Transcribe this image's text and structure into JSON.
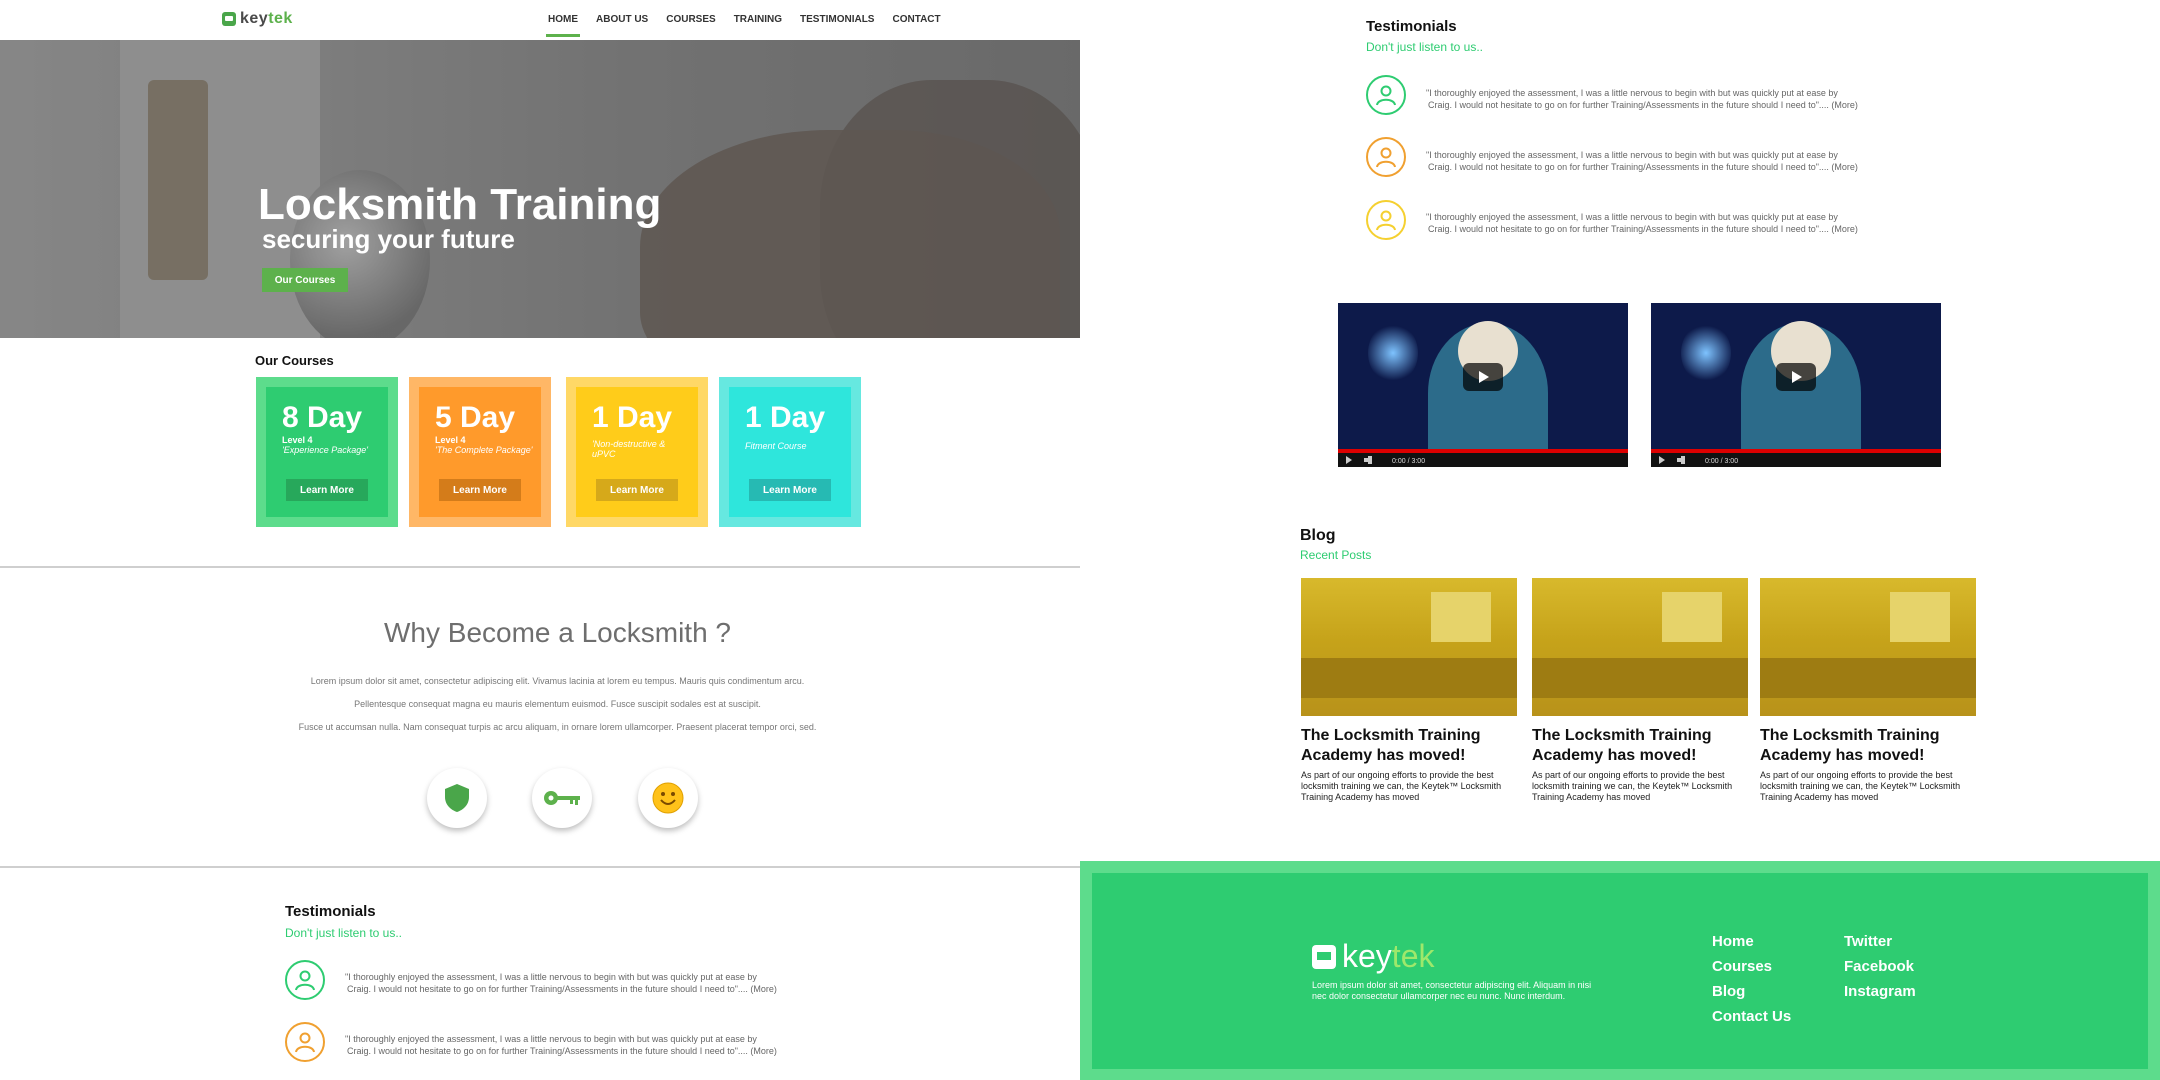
{
  "brand": {
    "logo_text_a": "key",
    "logo_text_b": "tek",
    "accent": "#5db14c",
    "green": "#2ecc71"
  },
  "nav": {
    "items": [
      {
        "label": "HOME",
        "active": true
      },
      {
        "label": "ABOUT US"
      },
      {
        "label": "COURSES"
      },
      {
        "label": "TRAINING"
      },
      {
        "label": "TESTIMONIALS"
      },
      {
        "label": "CONTACT"
      }
    ]
  },
  "hero": {
    "title": "Locksmith Training",
    "subtitle": "securing your future",
    "button": "Our Courses"
  },
  "courses": {
    "heading": "Our Courses",
    "items": [
      {
        "days": "8 Day",
        "level": "Level 4",
        "package": "'Experience Package'",
        "button": "Learn More",
        "outer": "#5ddc8c",
        "inner": "#2ecc71",
        "btn": "#27a85b"
      },
      {
        "days": "5 Day",
        "level": "Level 4",
        "package": "'The Complete Package'",
        "button": "Learn More",
        "outer": "#ffb766",
        "inner": "#ff9a2b",
        "btn": "#d47c1a"
      },
      {
        "days": "1 Day",
        "level": "",
        "package": "'Non-destructive & uPVC",
        "button": "Learn More",
        "outer": "#ffd866",
        "inner": "#ffcc1a",
        "btn": "#d6a91a"
      },
      {
        "days": "1 Day",
        "level": "",
        "package": "Fitment Course",
        "button": "Learn More",
        "outer": "#66e8e0",
        "inner": "#2ee6dc",
        "btn": "#26bab3"
      }
    ]
  },
  "why": {
    "title": "Why Become a Locksmith ?",
    "lines": [
      "Lorem ipsum dolor sit amet, consectetur adipiscing elit. Vivamus lacinia at lorem eu tempus. Mauris quis condimentum arcu.",
      "Pellentesque consequat magna eu mauris elementum euismod. Fusce suscipit sodales est at suscipit.",
      "Fusce ut accumsan nulla. Nam consequat turpis ac arcu aliquam, in ornare lorem ullamcorper. Praesent placerat tempor orci, sed."
    ],
    "icons": [
      "shield-icon",
      "key-icon",
      "smiley-icon"
    ]
  },
  "testimonials": {
    "title": "Testimonials",
    "subtitle": "Don't just listen to us..",
    "quote_line1": "\"I thoroughly enjoyed the assessment, I was a little nervous to begin with but was quickly put at ease by",
    "quote_line2": "Craig. I would not hesitate to go on for further Training/Assessments in the future should I need to\".... (More)",
    "colors": [
      "#2ecc71",
      "#f0a030",
      "#f5d030"
    ]
  },
  "videos": {
    "time": "0:00 / 3:00"
  },
  "blog": {
    "title": "Blog",
    "subtitle": "Recent Posts",
    "posts": [
      {
        "heading": "The Locksmith Training Academy has moved!",
        "body": "As part of our ongoing efforts to provide the best locksmith training we can, the Keytek™ Locksmith Training Academy has moved"
      },
      {
        "heading": "The Locksmith Training Academy has moved!",
        "body": "As part of our ongoing efforts to provide the best locksmith training we can, the Keytek™ Locksmith Training Academy has moved"
      },
      {
        "heading": "The Locksmith Training Academy has moved!",
        "body": "As part of our ongoing efforts to provide the best locksmith training we can, the Keytek™ Locksmith Training Academy has moved"
      }
    ]
  },
  "footer": {
    "text": "Lorem ipsum dolor sit amet, consectetur adipiscing elit. Aliquam in nisi nec dolor consectetur ullamcorper nec eu nunc. Nunc interdum.",
    "links_col1": [
      "Home",
      "Courses",
      "Blog",
      "Contact Us"
    ],
    "links_col2": [
      "Twitter",
      "Facebook",
      "Instagram"
    ]
  }
}
